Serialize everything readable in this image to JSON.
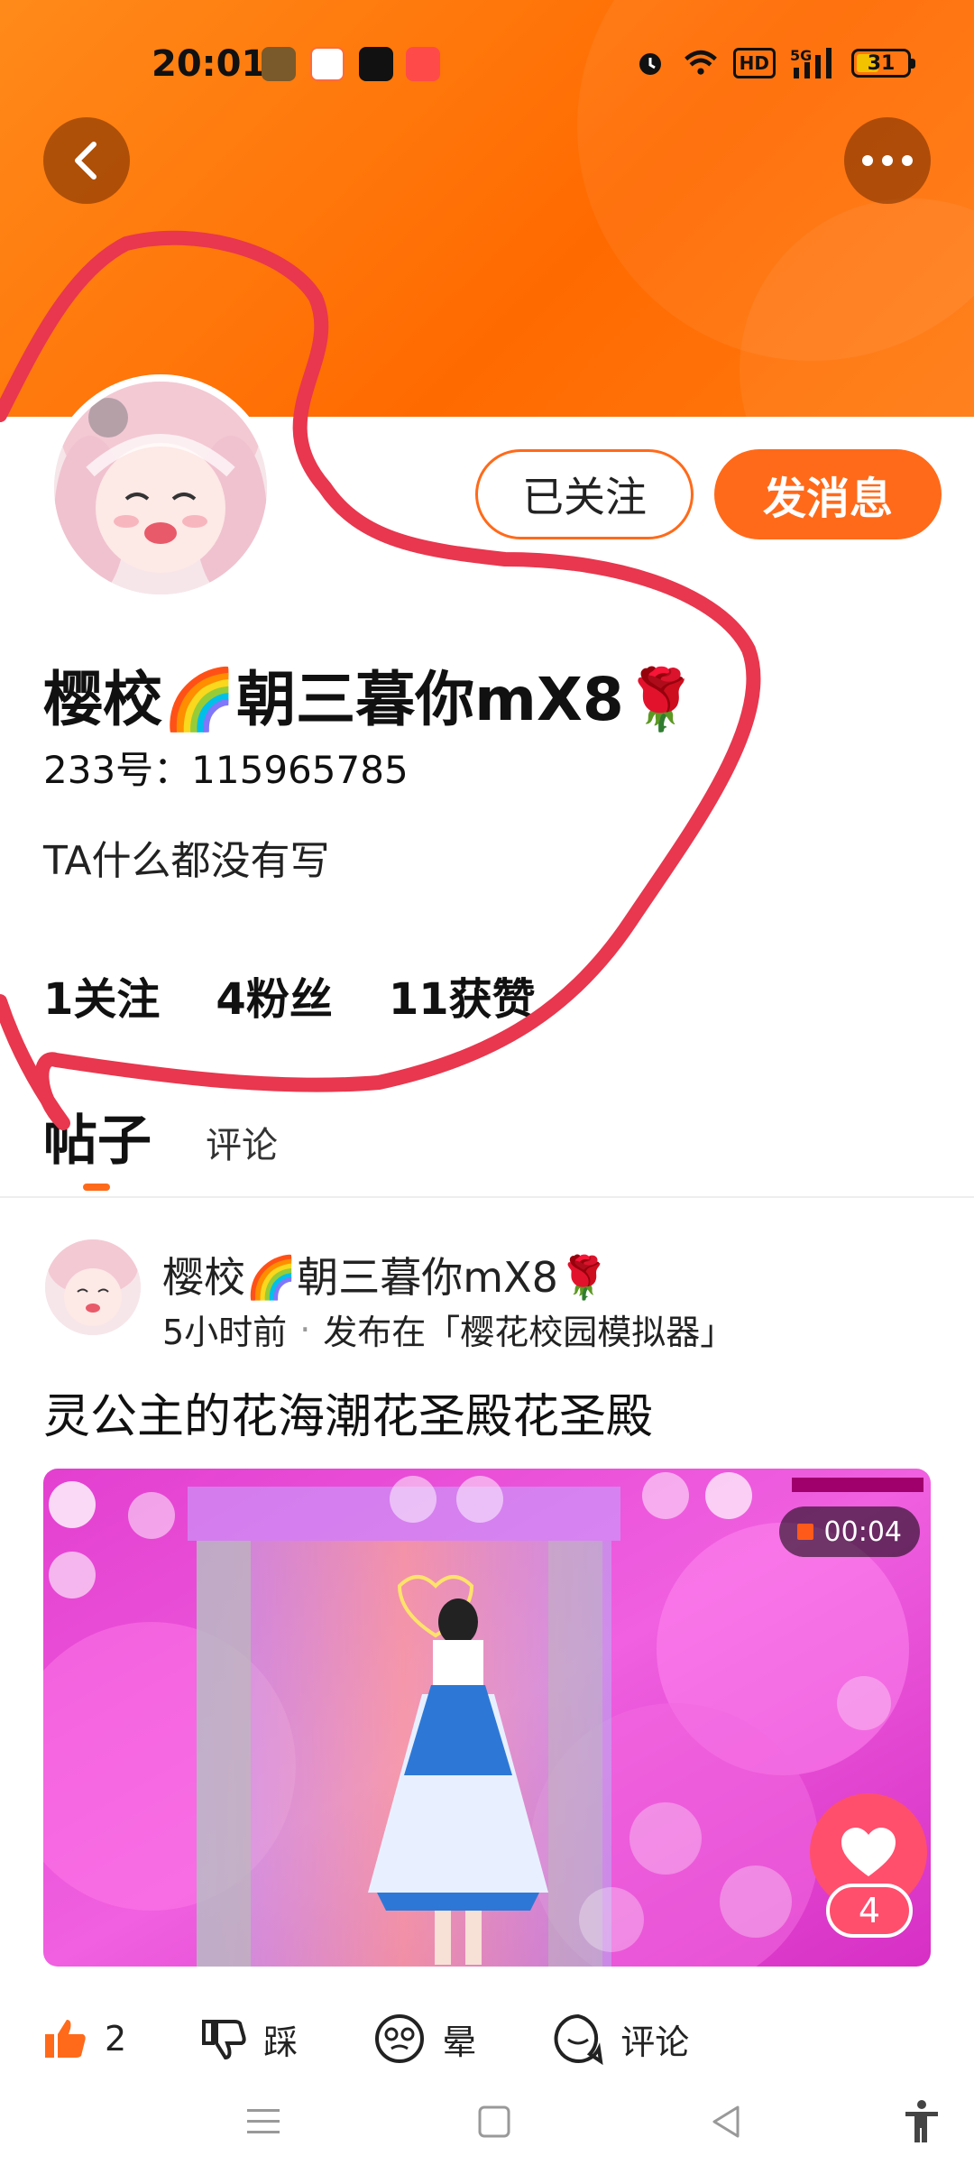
{
  "status_bar": {
    "time": "20:01",
    "hd": "HD",
    "network": "5G",
    "battery": "31"
  },
  "header": {
    "back_icon": "chevron-left-icon",
    "more_icon": "more-dots-icon"
  },
  "profile": {
    "follow_label": "已关注",
    "message_label": "发消息",
    "name": "樱校🌈朝三暮你mX8🌹",
    "id_text": "233号：115965785",
    "bio": "TA什么都没有写",
    "stats": [
      {
        "value": "1",
        "label": "关注"
      },
      {
        "value": "4",
        "label": "粉丝"
      },
      {
        "value": "11",
        "label": "获赞"
      }
    ]
  },
  "tabs": {
    "posts": "帖子",
    "comments": "评论"
  },
  "post": {
    "author": "樱校🌈朝三暮你mX8🌹",
    "time": "5小时前",
    "dot": "·",
    "published_in": "发布在「樱花校园模拟器」",
    "title": "灵公主的花海潮花圣殿花圣殿",
    "duration": "00:04",
    "like_count": "4",
    "actions": {
      "like_count": "2",
      "dislike": "踩",
      "dizzy": "晕",
      "comment": "评论"
    }
  },
  "colors": {
    "accent": "#ff6a1a",
    "header": "#ff7a10",
    "like": "#ff4f6d"
  }
}
